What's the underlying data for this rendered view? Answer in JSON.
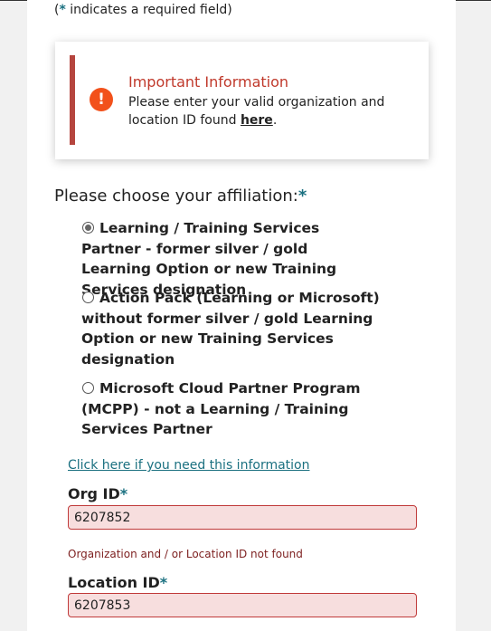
{
  "required_note": {
    "prefix": "(",
    "star": "*",
    "suffix": " indicates a required field)"
  },
  "info": {
    "icon": "exclamation-icon",
    "title": "Important Information",
    "text": "Please enter your valid organization and location ID found ",
    "link": "here",
    "period": "."
  },
  "affiliation": {
    "label": "Please choose your affiliation:",
    "star": "*",
    "options": [
      {
        "label": "Learning / Training Services Partner - former silver / gold Learning Option or new Training Services designation",
        "checked": true
      },
      {
        "label": "Action Pack (Learning or Microsoft) without former silver / gold Learning Option or new Training Services designation",
        "checked": false
      },
      {
        "label": "Microsoft Cloud Partner Program (MCPP) - not a Learning / Training Services Partner",
        "checked": false
      }
    ]
  },
  "help_link": "Click here if you need this information",
  "org_id": {
    "label": "Org ID",
    "star": "*",
    "value": "6207852",
    "error": "Organization and / or Location ID not found"
  },
  "location_id": {
    "label": "Location ID",
    "star": "*",
    "value": "6207853"
  },
  "colors": {
    "accent": "#1a7080",
    "error_bg": "#f7dede",
    "error_border": "#c03a3a",
    "info_bar": "#b5453e",
    "info_icon": "#f2511b"
  }
}
